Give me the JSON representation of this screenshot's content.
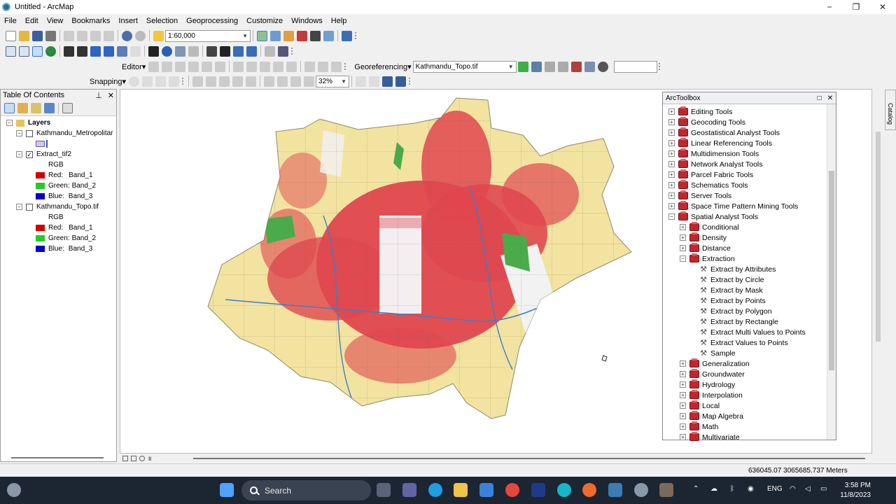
{
  "window": {
    "title": "Untitled - ArcMap",
    "minimize": "−",
    "maximize": "❐",
    "close": "✕"
  },
  "menu": [
    "File",
    "Edit",
    "View",
    "Bookmarks",
    "Insert",
    "Selection",
    "Geoprocessing",
    "Customize",
    "Windows",
    "Help"
  ],
  "standard_toolbar": {
    "scale": "1:60,000"
  },
  "editor_toolbar": {
    "editor_label": "Editor▾",
    "georef_label": "Georeferencing▾",
    "georef_layer": "Kathmandu_Topo.tif",
    "georef_text": ""
  },
  "snapping_toolbar": {
    "snapping_label": "Snapping▾",
    "zoom_percent": "32%"
  },
  "toc": {
    "title": "Table Of Contents",
    "pin": "⊥",
    "close": "✕",
    "root": "Layers",
    "layers": [
      {
        "name": "Kathmandu_Metropolitar",
        "checked": false
      },
      {
        "name": "Extract_tif2",
        "checked": true,
        "renderer": "RGB",
        "bands": [
          {
            "label": "Red:",
            "band": "Band_1",
            "color": "#d00000"
          },
          {
            "label": "Green:",
            "band": "Band_2",
            "color": "#22cc22"
          },
          {
            "label": "Blue:",
            "band": "Band_3",
            "color": "#0000cc"
          }
        ]
      },
      {
        "name": "Kathmandu_Topo.tif",
        "checked": false,
        "renderer": "RGB",
        "bands": [
          {
            "label": "Red:",
            "band": "Band_1",
            "color": "#d00000"
          },
          {
            "label": "Green:",
            "band": "Band_2",
            "color": "#22cc22"
          },
          {
            "label": "Blue:",
            "band": "Band_3",
            "color": "#0000cc"
          }
        ]
      }
    ]
  },
  "toolbox": {
    "title": "ArcToolbox",
    "top_items": [
      "Editing Tools",
      "Geocoding Tools",
      "Geostatistical Analyst Tools",
      "Linear Referencing Tools",
      "Multidimension Tools",
      "Network Analyst Tools",
      "Parcel Fabric Tools",
      "Schematics Tools",
      "Server Tools",
      "Space Time Pattern Mining Tools",
      "Spatial Analyst Tools"
    ],
    "spatial_children_before": [
      "Conditional",
      "Density",
      "Distance",
      "Extraction"
    ],
    "extraction_tools": [
      "Extract by Attributes",
      "Extract by Circle",
      "Extract by Mask",
      "Extract by Points",
      "Extract by Polygon",
      "Extract by Rectangle",
      "Extract Multi Values to Points",
      "Extract Values to Points",
      "Sample"
    ],
    "spatial_children_after": [
      "Generalization",
      "Groundwater",
      "Hydrology",
      "Interpolation",
      "Local",
      "Map Algebra",
      "Math",
      "Multivariate"
    ]
  },
  "catalog_tab": "Catalog",
  "status": {
    "coordinates": "636045.07  3065685.737 Meters"
  },
  "taskbar": {
    "search": "Search",
    "lang": "ENG",
    "time": "3:58 PM",
    "date": "11/8/2023"
  }
}
